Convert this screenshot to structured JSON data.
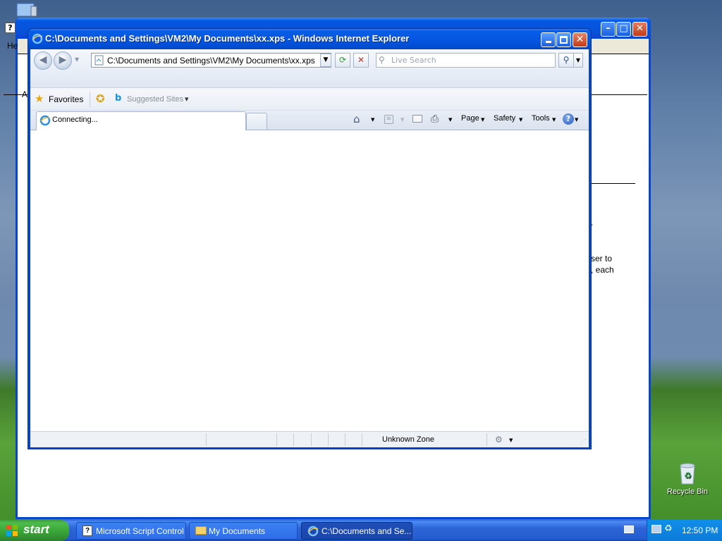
{
  "background_window": {
    "menu_fragment": "He",
    "address_fragment": "A",
    "text_lines": [
      ".",
      "ser to",
      ", each"
    ]
  },
  "ie": {
    "title": "C:\\Documents and Settings\\VM2\\My Documents\\xx.xps - Windows Internet Explorer",
    "address": "C:\\Documents and Settings\\VM2\\My Documents\\xx.xps",
    "search_placeholder": "Live Search",
    "favorites_label": "Favorites",
    "suggested_sites_label": "Suggested Sites",
    "tab_label": "Connecting...",
    "commands": {
      "page": "Page",
      "safety": "Safety",
      "tools": "Tools"
    },
    "status_zone": "Unknown Zone"
  },
  "taskbar": {
    "start_label": "start",
    "tasks": [
      {
        "label": "Microsoft Script Control"
      },
      {
        "label": "My Documents"
      },
      {
        "label": "C:\\Documents and Se..."
      }
    ],
    "clock": "12:50 PM"
  },
  "desktop": {
    "recycle_bin_label": "Recycle Bin"
  },
  "colors": {
    "title_blue": "#0454e0",
    "close_red": "#c43a17",
    "start_green": "#37a236",
    "taskbar_blue": "#245dd1"
  },
  "icons": [
    "ie-icon",
    "back-icon",
    "forward-icon",
    "refresh-icon",
    "stop-icon",
    "search-icon",
    "star-icon",
    "home-icon",
    "feeds-icon",
    "mail-icon",
    "print-icon",
    "help-icon",
    "recycle-bin-icon",
    "windows-logo-icon"
  ]
}
